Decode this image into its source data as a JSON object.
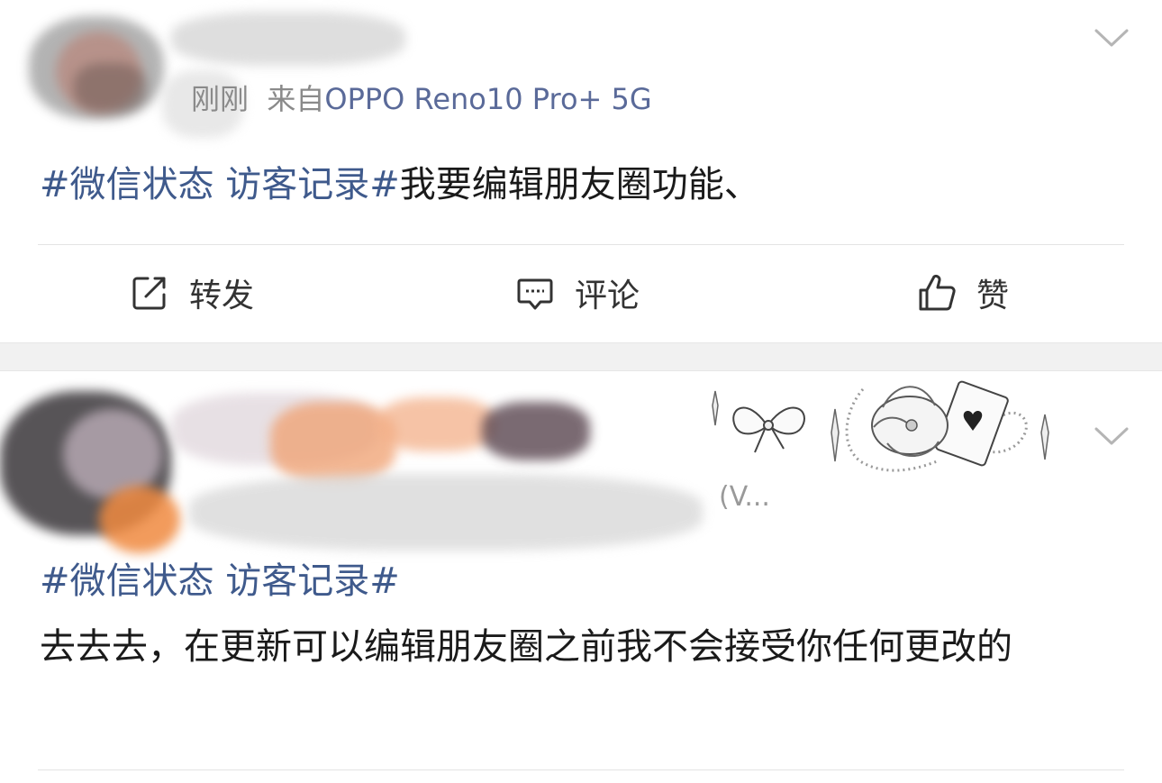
{
  "posts": [
    {
      "meta": {
        "time": "刚刚",
        "source_prefix": "来自",
        "device": "OPPO Reno10 Pro+ 5G"
      },
      "content": {
        "topic": "#微信状态 访客记录#",
        "text": "我要编辑朋友圈功能、"
      },
      "actions": {
        "repost": "转发",
        "comment": "评论",
        "like": "赞"
      }
    },
    {
      "meta": {
        "truncated": "(V..."
      },
      "content": {
        "topic": "#微信状态 访客记录#",
        "text": "去去去，在更新可以编辑朋友圈之前我不会接受你任何更改的"
      }
    }
  ],
  "icons": {
    "repost": "repost-icon",
    "comment": "comment-icon",
    "like": "thumbs-up-icon",
    "menu": "chevron-down-icon"
  },
  "colors": {
    "topic": "#3f5a8c",
    "device": "#5a6a99",
    "separator": "#f1f1f1"
  }
}
